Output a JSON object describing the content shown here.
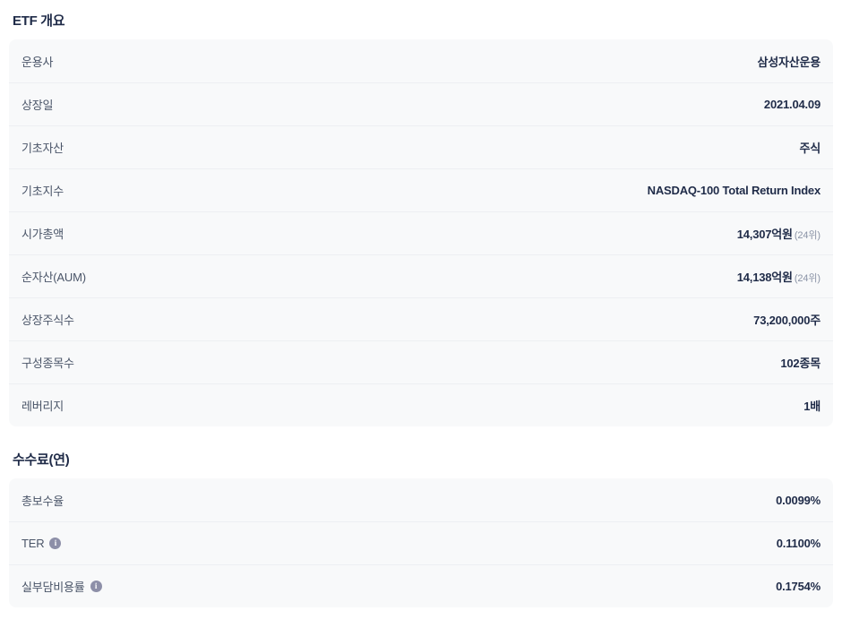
{
  "overview": {
    "title": "ETF 개요",
    "rows": [
      {
        "label": "운용사",
        "value": "삼성자산운용"
      },
      {
        "label": "상장일",
        "value": "2021.04.09"
      },
      {
        "label": "기초자산",
        "value": "주식"
      },
      {
        "label": "기초지수",
        "value": "NASDAQ-100 Total Return Index"
      },
      {
        "label": "시가총액",
        "value": "14,307억원",
        "rank": "(24위)"
      },
      {
        "label": "순자산(AUM)",
        "value": "14,138억원",
        "rank": "(24위)"
      },
      {
        "label": "상장주식수",
        "value": "73,200,000주"
      },
      {
        "label": "구성종목수",
        "value": "102종목"
      },
      {
        "label": "레버리지",
        "value": "1배"
      }
    ]
  },
  "fees": {
    "title": "수수료(연)",
    "rows": [
      {
        "label": "총보수율",
        "value": "0.0099%"
      },
      {
        "label": "TER",
        "value": "0.1100%",
        "icon": "info-icon"
      },
      {
        "label": "실부담비용률",
        "value": "0.1754%",
        "icon": "info-icon"
      }
    ]
  },
  "icons": {
    "info": "i"
  },
  "colors": {
    "row_background": "#f8f9fa",
    "value_text": "#1f2b48",
    "label_text": "#4a5568",
    "rank_text": "#8a93a6",
    "info_icon": "#8d8fa8",
    "divider": "#edeff2"
  }
}
